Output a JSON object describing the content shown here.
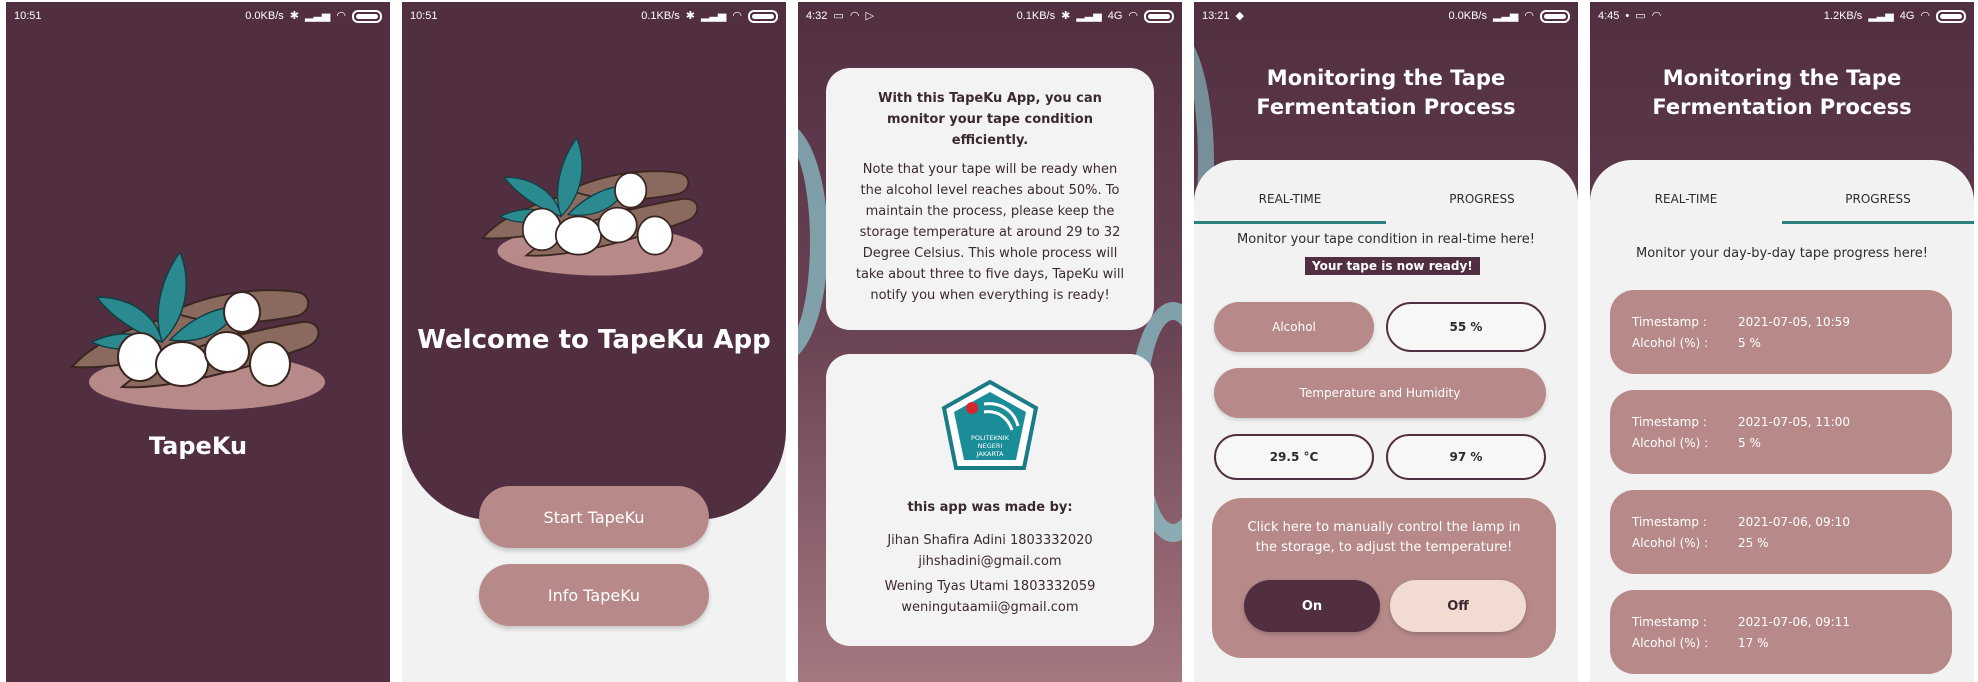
{
  "screens": [
    {
      "status": {
        "time": "10:51",
        "speed": "0.0KB/s",
        "network": ""
      },
      "app_name": "TapeKu"
    },
    {
      "status": {
        "time": "10:51",
        "speed": "0.1KB/s",
        "network": ""
      },
      "welcome": "Welcome to TapeKu App",
      "start_button": "Start TapeKu",
      "info_button": "Info TapeKu"
    },
    {
      "status": {
        "time": "4:32",
        "speed": "0.1KB/s",
        "network": "4G"
      },
      "intro": "With this TapeKu App, you can monitor your tape condition efficiently.",
      "note": "Note that your tape will be ready when the alcohol level reaches about 50%. To maintain the process, please keep the storage temperature at around 29 to 32 Degree Celsius. This whole process will take about three to five days, TapeKu will notify you when everything is ready!",
      "seal_text": [
        "POLITEKNIK",
        "NEGERI",
        "JAKARTA"
      ],
      "made_by": "this app was made by:",
      "authors": [
        {
          "name": "Jihan Shafira Adini 1803332020",
          "email": "jihshadini@gmail.com"
        },
        {
          "name": "Wening Tyas Utami 1803332059",
          "email": "weningutaamii@gmail.com"
        }
      ]
    },
    {
      "status": {
        "time": "13:21",
        "speed": "0.0KB/s",
        "network": ""
      },
      "title": "Monitoring the Tape Fermentation Process",
      "tabs": [
        "REAL-TIME",
        "PROGRESS"
      ],
      "subtitle": "Monitor your tape condition in real-time here!",
      "ready_badge": "Your tape is now ready!",
      "alcohol_label": "Alcohol",
      "alcohol_value": "55 %",
      "temp_humidity_label": "Temperature and Humidity",
      "temperature_value": "29.5 °C",
      "humidity_value": "97 %",
      "lamp_text": "Click here to manually control the lamp in the storage, to adjust the temperature!",
      "on_button": "On",
      "off_button": "Off"
    },
    {
      "status": {
        "time": "4:45",
        "speed": "1.2KB/s",
        "network": "4G"
      },
      "title": "Monitoring the Tape Fermentation Process",
      "tabs": [
        "REAL-TIME",
        "PROGRESS"
      ],
      "subtitle": "Monitor your day-by-day tape progress here!",
      "timestamp_label": "Timestamp :",
      "alcohol_label": "Alcohol (%) :",
      "logs": [
        {
          "timestamp": "2021-07-05, 10:59",
          "alcohol": "5 %"
        },
        {
          "timestamp": "2021-07-05, 11:00",
          "alcohol": "5 %"
        },
        {
          "timestamp": "2021-07-06, 09:10",
          "alcohol": "25 %"
        },
        {
          "timestamp": "2021-07-06, 09:11",
          "alcohol": "17 %"
        }
      ]
    }
  ],
  "colors": {
    "plum": "#512f41",
    "rose": "#b78a89",
    "teal": "#2d7f80",
    "light": "#f2f2f2",
    "cream": "#f2dcd1"
  }
}
